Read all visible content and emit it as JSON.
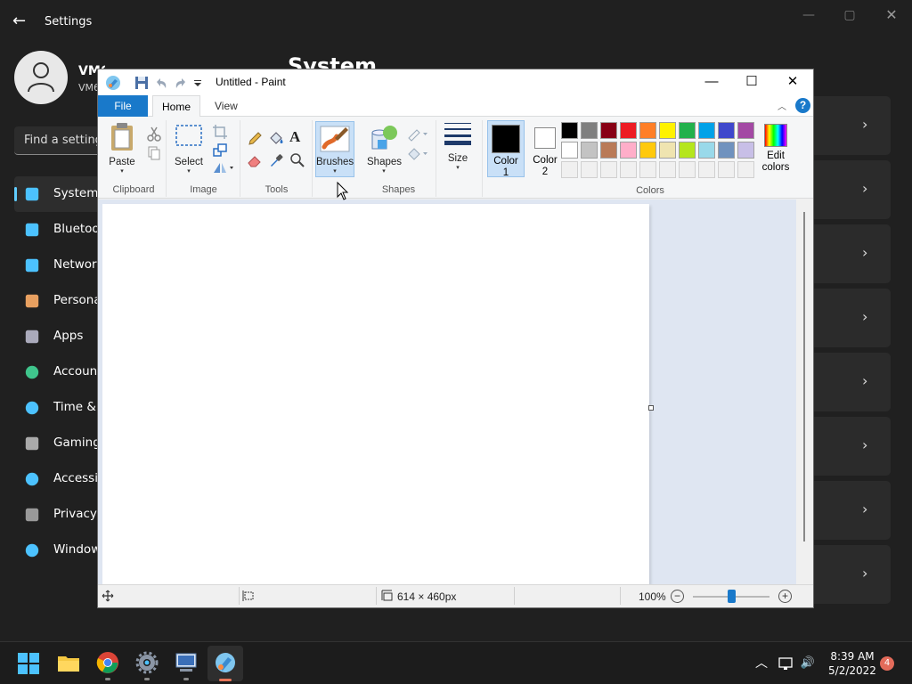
{
  "settings": {
    "back_glyph": "←",
    "title": "Settings",
    "minimize_glyph": "—",
    "maximize_glyph": "▢",
    "close_glyph": "✕",
    "user_name": "VM6",
    "user_sub": "VM6",
    "search_placeholder": "Find a setting",
    "page_heading": "System",
    "nav": [
      {
        "label": "System",
        "icon": "monitor-icon",
        "color": "#4cc2ff"
      },
      {
        "label": "Bluetooth & devices",
        "icon": "bluetooth-icon",
        "color": "#4cc2ff"
      },
      {
        "label": "Network & internet",
        "icon": "wifi-icon",
        "color": "#4cc2ff"
      },
      {
        "label": "Personalization",
        "icon": "brush-icon",
        "color": "#e8a060"
      },
      {
        "label": "Apps",
        "icon": "apps-icon",
        "color": "#aab"
      },
      {
        "label": "Accounts",
        "icon": "person-icon",
        "color": "#3fc58c"
      },
      {
        "label": "Time & language",
        "icon": "clock-icon",
        "color": "#4cc2ff"
      },
      {
        "label": "Gaming",
        "icon": "gamepad-icon",
        "color": "#aaa"
      },
      {
        "label": "Accessibility",
        "icon": "accessibility-icon",
        "color": "#4cc2ff"
      },
      {
        "label": "Privacy & security",
        "icon": "shield-icon",
        "color": "#999"
      },
      {
        "label": "Windows Update",
        "icon": "update-icon",
        "color": "#4cc2ff"
      }
    ],
    "card_chevron": "›"
  },
  "paint": {
    "title": "Untitled - Paint",
    "minimize_glyph": "—",
    "maximize_glyph": "☐",
    "close_glyph": "✕",
    "tabs": {
      "file": "File",
      "home": "Home",
      "view": "View"
    },
    "collapse_glyph": "︿",
    "help_glyph": "?",
    "groups": {
      "clipboard": "Clipboard",
      "image": "Image",
      "tools": "Tools",
      "shapes": "Shapes",
      "colors": "Colors"
    },
    "buttons": {
      "paste": "Paste",
      "select": "Select",
      "brushes": "Brushes",
      "shapes": "Shapes",
      "size": "Size",
      "color1_a": "Color",
      "color1_b": "1",
      "color2_a": "Color",
      "color2_b": "2",
      "edit_colors_a": "Edit",
      "edit_colors_b": "colors",
      "dropdown_glyph": "▾"
    },
    "palette_row1": [
      "#000000",
      "#7f7f7f",
      "#880015",
      "#ed1c24",
      "#ff7f27",
      "#fff200",
      "#22b14c",
      "#00a2e8",
      "#3f48cc",
      "#a349a4"
    ],
    "palette_row2": [
      "#ffffff",
      "#c3c3c3",
      "#b97a57",
      "#ffaec9",
      "#ffc90e",
      "#efe4b0",
      "#b5e61d",
      "#99d9ea",
      "#7092be",
      "#c8bfe7"
    ],
    "palette_row3": [
      "#f0f0f0",
      "#f0f0f0",
      "#f0f0f0",
      "#f0f0f0",
      "#f0f0f0",
      "#f0f0f0",
      "#f0f0f0",
      "#f0f0f0",
      "#f0f0f0",
      "#f0f0f0"
    ],
    "status": {
      "canvas_size": "614 × 460px",
      "zoom": "100%",
      "zoom_out_glyph": "−",
      "zoom_in_glyph": "+"
    }
  },
  "taskbar": {
    "time": "8:39 AM",
    "date": "5/2/2022",
    "notifications": "4",
    "tray_chevron": "︿",
    "volume_glyph": "🔊"
  }
}
